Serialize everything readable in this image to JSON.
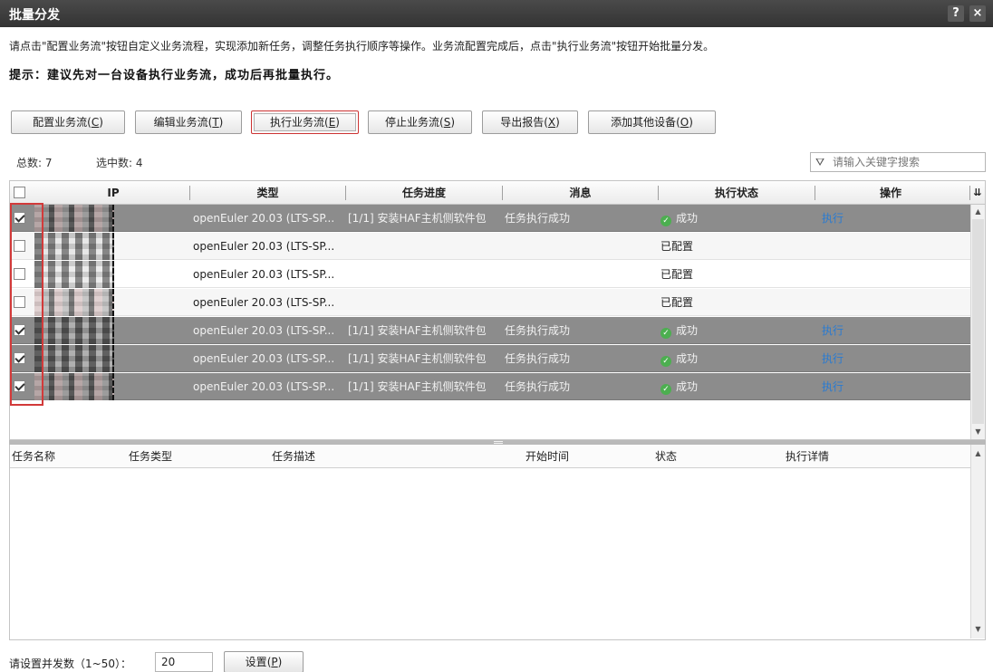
{
  "window": {
    "title": "批量分发",
    "help_label": "?",
    "close_label": "×"
  },
  "description": "请点击\"配置业务流\"按钮自定义业务流程，实现添加新任务，调整任务执行顺序等操作。业务流配置完成后，点击\"执行业务流\"按钮开始批量分发。",
  "tip": "提示：建议先对一台设备执行业务流，成功后再批量执行。",
  "toolbar": {
    "configure": {
      "label": "配置业务流",
      "key": "C"
    },
    "edit": {
      "label": "编辑业务流",
      "key": "T"
    },
    "execute": {
      "label": "执行业务流",
      "key": "E"
    },
    "stop": {
      "label": "停止业务流",
      "key": "S"
    },
    "export": {
      "label": "导出报告",
      "key": "X"
    },
    "add_device": {
      "label": "添加其他设备",
      "key": "O"
    }
  },
  "summary": {
    "total_label": "总数:",
    "total": "7",
    "selected_label": "选中数:",
    "selected": "4"
  },
  "search": {
    "placeholder": "请输入关键字搜索",
    "icon": "filter-icon"
  },
  "grid": {
    "columns": [
      "IP",
      "类型",
      "任务进度",
      "消息",
      "执行状态",
      "操作"
    ],
    "rows": [
      {
        "checked": true,
        "selected": true,
        "type": "openEuler 20.03 (LTS-SP...",
        "progress": "[1/1] 安装HAF主机侧软件包",
        "message": "任务执行成功",
        "status": "成功",
        "status_icon": "check-circle-icon",
        "action": "执行"
      },
      {
        "checked": false,
        "selected": false,
        "type": "openEuler 20.03 (LTS-SP...",
        "progress": "",
        "message": "",
        "status": "已配置",
        "status_icon": "",
        "action": ""
      },
      {
        "checked": false,
        "selected": false,
        "type": "openEuler 20.03 (LTS-SP...",
        "progress": "",
        "message": "",
        "status": "已配置",
        "status_icon": "",
        "action": ""
      },
      {
        "checked": false,
        "selected": false,
        "type": "openEuler 20.03 (LTS-SP...",
        "progress": "",
        "message": "",
        "status": "已配置",
        "status_icon": "",
        "action": ""
      },
      {
        "checked": true,
        "selected": true,
        "type": "openEuler 20.03 (LTS-SP...",
        "progress": "[1/1] 安装HAF主机侧软件包",
        "message": "任务执行成功",
        "status": "成功",
        "status_icon": "check-circle-icon",
        "action": "执行"
      },
      {
        "checked": true,
        "selected": true,
        "type": "openEuler 20.03 (LTS-SP...",
        "progress": "[1/1] 安装HAF主机侧软件包",
        "message": "任务执行成功",
        "status": "成功",
        "status_icon": "check-circle-icon",
        "action": "执行"
      },
      {
        "checked": true,
        "selected": true,
        "type": "openEuler 20.03 (LTS-SP...",
        "progress": "[1/1] 安装HAF主机侧软件包",
        "message": "任务执行成功",
        "status": "成功",
        "status_icon": "check-circle-icon",
        "action": "执行"
      }
    ]
  },
  "task_grid": {
    "columns": [
      "任务名称",
      "任务类型",
      "任务描述",
      "开始时间",
      "状态",
      "执行详情"
    ]
  },
  "concurrency": {
    "label": "请设置并发数（1~50）：",
    "value": "20",
    "set_label": "设置",
    "set_key": "P"
  },
  "colors": {
    "titlebar": "#3a3a3a",
    "selected_row": "#8c8c8c",
    "highlight_border": "#d23a3a",
    "link": "#2a7bd1",
    "success": "#4caf50"
  }
}
